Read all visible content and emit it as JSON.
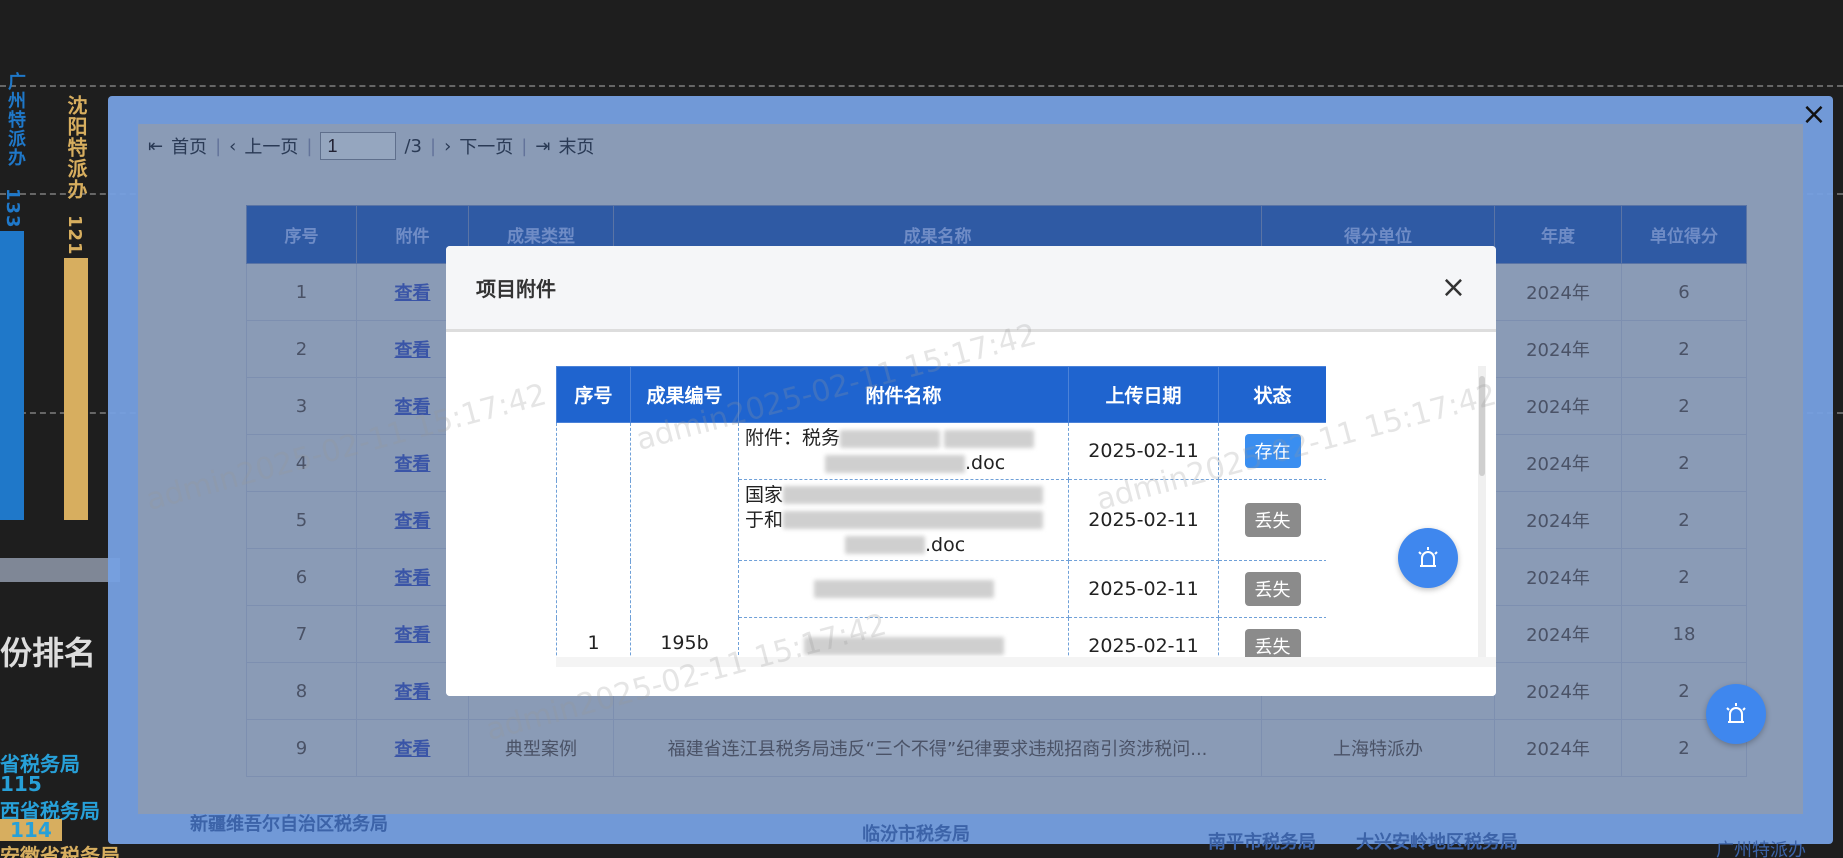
{
  "background": {
    "bars": [
      {
        "label": "广州特派办",
        "value": "133",
        "color": "#1f78c9"
      },
      {
        "label": "沈阳特派办",
        "value": "121",
        "color": "#d7ae5f"
      }
    ],
    "ranking_title": "份排名",
    "ranks": [
      {
        "label": "省税务局",
        "color": "#27a0d8"
      },
      {
        "label": "115",
        "color": "#27a0d8"
      },
      {
        "label": "西省税务局",
        "color": "#27a0d8"
      },
      {
        "label": "114",
        "color": "#27a0d8"
      },
      {
        "label": "安徽省税务局",
        "color": "#d7ae5f"
      }
    ]
  },
  "outer_dialog": {
    "close": "×",
    "pager": {
      "first": "首页",
      "prev": "上一页",
      "page_value": "1",
      "total": "/3",
      "next": "下一页",
      "last": "末页"
    },
    "table": {
      "headers": [
        "序号",
        "附件",
        "成果类型",
        "成果名称",
        "得分单位",
        "年度",
        "单位得分"
      ],
      "rows": [
        {
          "no": "1",
          "link": "查看",
          "type": "",
          "name": "",
          "unit": "",
          "year": "2024年",
          "score": "6"
        },
        {
          "no": "2",
          "link": "查看",
          "type": "",
          "name": "",
          "unit": "",
          "year": "2024年",
          "score": "2"
        },
        {
          "no": "3",
          "link": "查看",
          "type": "",
          "name": "",
          "unit": "",
          "year": "2024年",
          "score": "2"
        },
        {
          "no": "4",
          "link": "查看",
          "type": "",
          "name": "",
          "unit": "",
          "year": "2024年",
          "score": "2"
        },
        {
          "no": "5",
          "link": "查看",
          "type": "",
          "name": "",
          "unit": "",
          "year": "2024年",
          "score": "2"
        },
        {
          "no": "6",
          "link": "查看",
          "type": "",
          "name": "",
          "unit": "",
          "year": "2024年",
          "score": "2"
        },
        {
          "no": "7",
          "link": "查看",
          "type": "",
          "name": "",
          "unit": "",
          "year": "2024年",
          "score": "18"
        },
        {
          "no": "8",
          "link": "查看",
          "type": "",
          "name": "",
          "unit": "",
          "year": "2024年",
          "score": "2"
        },
        {
          "no": "9",
          "link": "查看",
          "type": "典型案例",
          "name": "福建省连江县税务局违反“三个不得”纪律要求违规招商引资涉税问...",
          "unit": "上海特派办",
          "year": "2024年",
          "score": "2"
        }
      ]
    },
    "footer_labels": [
      "新疆维吾尔自治区税务局",
      "临汾市税务局",
      "南平市税务局",
      "大兴安岭地区税务局",
      "广州特派办"
    ]
  },
  "modal": {
    "title": "项目附件",
    "close": "×",
    "headers": [
      "序号",
      "成果编号",
      "附件名称",
      "上传日期",
      "状态"
    ],
    "group": {
      "no": "1",
      "code": "195b"
    },
    "rows": [
      {
        "name_prefix": "附件：税务",
        "name_suffix": ".doc",
        "date": "2025-02-11",
        "status": "存在",
        "status_type": "ok"
      },
      {
        "name_prefix": "国家",
        "name_mid": "于和",
        "name_suffix": ".doc",
        "date": "2025-02-11",
        "status": "丢失",
        "status_type": "lost"
      },
      {
        "name_prefix": "",
        "name_suffix": "",
        "date": "2025-02-11",
        "status": "丢失",
        "status_type": "lost"
      },
      {
        "name_prefix": "",
        "name_suffix": "",
        "date": "2025-02-11",
        "status": "丢失",
        "status_type": "lost"
      }
    ]
  },
  "watermark": "admin2025-02-11 15:17:42",
  "colors": {
    "accent": "#1f64cf",
    "fab": "#3f87ee",
    "overlay": "#76a0e2"
  }
}
